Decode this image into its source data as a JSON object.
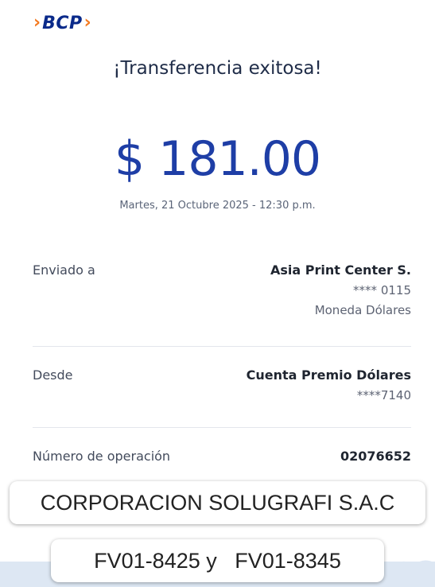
{
  "brand": {
    "name": "BCP",
    "chevron": "›"
  },
  "title": "¡Transferencia exitosa!",
  "amount": "$ 181.00",
  "datetime": "Martes, 21 Octubre 2025 - 12:30 p.m.",
  "sent_to": {
    "label": "Enviado a",
    "name": "Asia Print Center S.",
    "account": "**** 0115",
    "currency": "Moneda Dólares"
  },
  "from": {
    "label": "Desde",
    "account_name": "Cuenta Premio Dólares",
    "account": "****7140"
  },
  "operation": {
    "label": "Número de operación",
    "number": "02076652"
  },
  "overlays": {
    "company": "CORPORACION SOLUGRAFI S.A.C",
    "invoices": "FV01-8425 y   FV01-8345"
  },
  "colors": {
    "amount": "#1e3ea6",
    "brand_blue": "#0a2a8a",
    "brand_orange": "#f47a20"
  }
}
